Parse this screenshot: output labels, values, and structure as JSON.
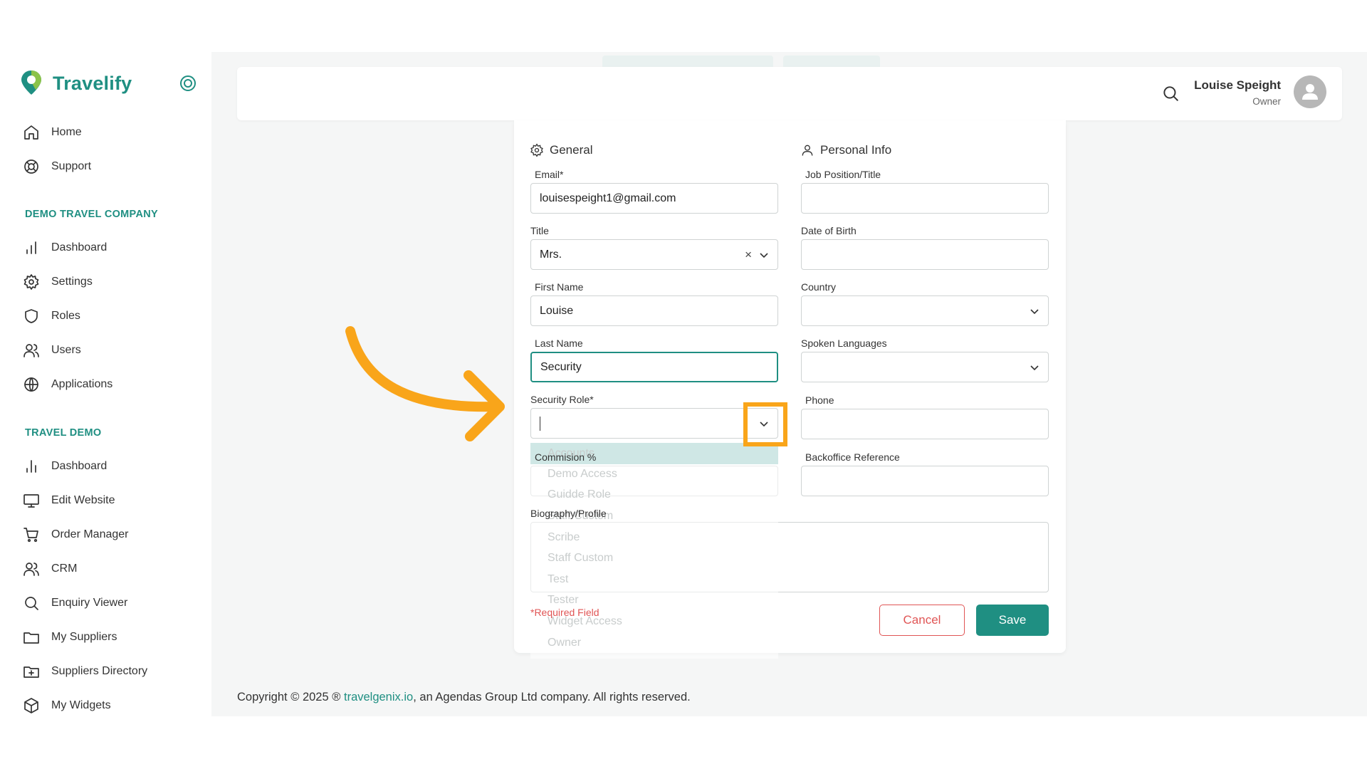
{
  "app": {
    "name": "Travelify"
  },
  "sidebar": {
    "top_items": [
      {
        "label": "Home",
        "icon": "home-icon"
      },
      {
        "label": "Support",
        "icon": "lifebuoy-icon"
      }
    ],
    "sections": [
      {
        "title": "DEMO TRAVEL COMPANY",
        "items": [
          {
            "label": "Dashboard",
            "icon": "bar-chart-icon"
          },
          {
            "label": "Settings",
            "icon": "gear-icon"
          },
          {
            "label": "Roles",
            "icon": "shield-icon"
          },
          {
            "label": "Users",
            "icon": "users-icon"
          },
          {
            "label": "Applications",
            "icon": "globe-icon"
          }
        ]
      },
      {
        "title": "TRAVEL DEMO",
        "items": [
          {
            "label": "Dashboard",
            "icon": "bar-chart-icon"
          },
          {
            "label": "Edit Website",
            "icon": "monitor-icon"
          },
          {
            "label": "Order Manager",
            "icon": "cart-icon"
          },
          {
            "label": "CRM",
            "icon": "users-icon"
          },
          {
            "label": "Enquiry Viewer",
            "icon": "search-icon"
          },
          {
            "label": "My Suppliers",
            "icon": "folder-icon"
          },
          {
            "label": "Suppliers Directory",
            "icon": "folder-plus-icon"
          },
          {
            "label": "My Widgets",
            "icon": "cube-icon"
          }
        ]
      }
    ]
  },
  "header": {
    "user_name": "Louise Speight",
    "user_role": "Owner"
  },
  "form": {
    "general_heading": "General",
    "personal_heading": "Personal Info",
    "email_label": "Email*",
    "email_value": "louisespeight1@gmail.com",
    "title_label": "Title",
    "title_value": "Mrs.",
    "first_name_label": "First Name",
    "first_name_value": "Louise",
    "last_name_label": "Last Name",
    "last_name_value": "Security",
    "security_role_label": "Security Role*",
    "commission_label": "Commision %",
    "biography_label": "Biography/Profile",
    "job_label": "Job Position/Title",
    "dob_label": "Date of Birth",
    "country_label": "Country",
    "languages_label": "Spoken Languages",
    "phone_label": "Phone",
    "backoffice_label": "Backoffice Reference",
    "required_note": "*Required Field",
    "cancel_label": "Cancel",
    "save_label": "Save"
  },
  "security_role_options": [
    "Accounts",
    "Demo Access",
    "Guidde Role",
    "Staff Custom",
    "Scribe",
    "Staff Custom",
    "Test",
    "Tester",
    "Widget Access",
    "Owner"
  ],
  "footer": {
    "prefix": "Copyright © 2025 ® ",
    "link": "travelgenix.io",
    "suffix": ", an Agendas Group Ltd company. All rights reserved."
  },
  "colors": {
    "brand": "#1f8f82",
    "danger": "#e05555",
    "highlight": "#f9a51a"
  }
}
